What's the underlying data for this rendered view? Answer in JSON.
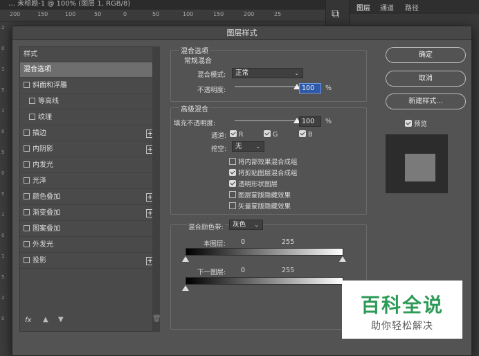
{
  "topbar": {
    "title": "… 未标题-1 @ 100% (图层 1, RGB/8)"
  },
  "ruler": {
    "ticks": [
      "200",
      "150",
      "100",
      "50",
      "0",
      "50",
      "100",
      "150",
      "200",
      "25"
    ]
  },
  "left_ruler": {
    "ticks": [
      "2",
      "0",
      "1",
      "5",
      "1",
      "0",
      "5",
      "0",
      "5",
      "1",
      "0",
      "1",
      "5",
      "2",
      "0"
    ]
  },
  "panel": {
    "tabs": [
      "图层",
      "通道",
      "路径"
    ]
  },
  "dialog": {
    "title": "图层样式",
    "styles_header": "样式",
    "items": [
      {
        "label": "混合选项",
        "selected": true,
        "checkbox": false,
        "plus": false,
        "indent": false
      },
      {
        "label": "斜面和浮雕",
        "checkbox": true,
        "plus": false,
        "indent": false
      },
      {
        "label": "等高线",
        "checkbox": true,
        "plus": false,
        "indent": true
      },
      {
        "label": "纹理",
        "checkbox": true,
        "plus": false,
        "indent": true
      },
      {
        "label": "描边",
        "checkbox": true,
        "plus": true,
        "indent": false
      },
      {
        "label": "内阴影",
        "checkbox": true,
        "plus": true,
        "indent": false
      },
      {
        "label": "内发光",
        "checkbox": true,
        "plus": false,
        "indent": false
      },
      {
        "label": "光泽",
        "checkbox": true,
        "plus": false,
        "indent": false
      },
      {
        "label": "颜色叠加",
        "checkbox": true,
        "plus": true,
        "indent": false
      },
      {
        "label": "渐变叠加",
        "checkbox": true,
        "plus": true,
        "indent": false
      },
      {
        "label": "图案叠加",
        "checkbox": true,
        "plus": false,
        "indent": false
      },
      {
        "label": "外发光",
        "checkbox": true,
        "plus": false,
        "indent": false
      },
      {
        "label": "投影",
        "checkbox": true,
        "plus": true,
        "indent": false
      }
    ],
    "footer": {
      "fx": "fx"
    },
    "blend": {
      "section_title": "混合选项",
      "general_title": "常规混合",
      "mode_label": "混合模式:",
      "mode_value": "正常",
      "opacity_label": "不透明度:",
      "opacity_value": "100",
      "percent": "%",
      "opacity_fraction": 1.0
    },
    "advanced": {
      "title": "高级混合",
      "fill_label": "填充不透明度:",
      "fill_value": "100",
      "percent": "%",
      "fill_fraction": 1.0,
      "channels_label": "通道:",
      "channels": [
        "R",
        "G",
        "B"
      ],
      "knockout_label": "挖空:",
      "knockout_value": "无",
      "options": [
        {
          "label": "将内部效果混合成组",
          "checked": false
        },
        {
          "label": "将剪贴图层混合成组",
          "checked": true
        },
        {
          "label": "透明形状图层",
          "checked": true
        },
        {
          "label": "图层蒙版隐藏效果",
          "checked": false
        },
        {
          "label": "矢量蒙版隐藏效果",
          "checked": false
        }
      ]
    },
    "blendif": {
      "label": "混合颜色带:",
      "value": "灰色",
      "this_layer": "本图层:",
      "underlying": "下一图层:",
      "min": "0",
      "max": "255"
    },
    "buttons": {
      "ok": "确定",
      "cancel": "取消",
      "new_style": "新建样式..."
    },
    "preview_label": "预览"
  },
  "watermark": {
    "title": "百科全说",
    "subtitle": "助你轻松解决",
    "color": "#2e9a57"
  }
}
